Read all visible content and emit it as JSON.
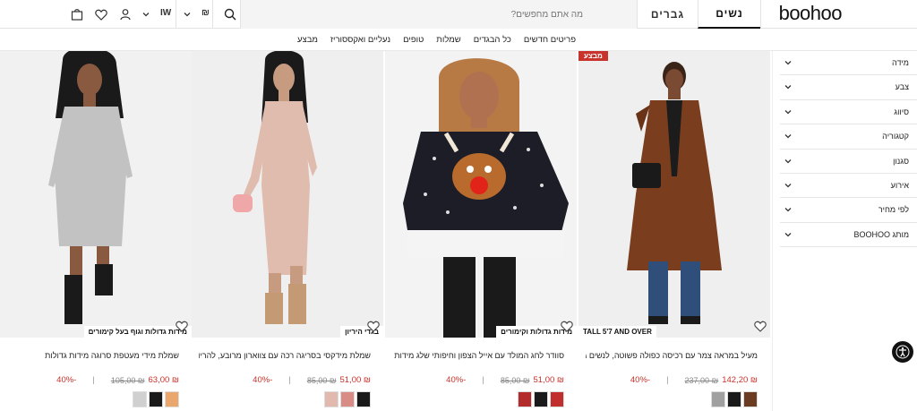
{
  "header": {
    "logo": "boohoo",
    "tabs": [
      {
        "label": "נשים",
        "active": true
      },
      {
        "label": "גברים",
        "active": false
      }
    ],
    "search": {
      "placeholder": "מה אתם מחפשים?"
    },
    "currency": "₪",
    "language": "IW",
    "icons": [
      "search-icon",
      "chevron-down-icon",
      "user-icon",
      "heart-icon",
      "bag-icon"
    ]
  },
  "category_nav": [
    "פריטים חדשים",
    "כל הבגדים",
    "שמלות",
    "טופים",
    "נעליים ואקססוריז",
    "מבצע"
  ],
  "filters": [
    "מידה",
    "צבע",
    "סיווג",
    "קטגוריה",
    "סגנון",
    "אירוע",
    "לפי מחיר",
    "מותג BOOHOO"
  ],
  "products": [
    {
      "title": "מעיל במראה צמר עם רכיסה כפולה פשוטה, לנשים גבוהות",
      "tag": "TALL 5'7 AND OVER",
      "badge": "מבצע",
      "price_now": "₪ 142,20",
      "price_was": "₪ 237,00",
      "discount": "-40%",
      "swatches": [
        "#a0a0a0",
        "#1a1a1a",
        "#6b3c22"
      ]
    },
    {
      "title": "סוודר לחג המולד עם אייל הצפון וחיפותי שלג מידות גדולות",
      "tag": "מידות גדולות וקימורים",
      "badge": "",
      "price_now": "₪ 51,00",
      "price_was": "₪ 85,00",
      "discount": "-40%",
      "swatches": [
        "#b42b2b",
        "#1a1a1a",
        "#c12e2e"
      ]
    },
    {
      "title": "שמלת מידקסי בסריגה רכה עם צווארון מרובע, להריון",
      "tag": "בגדי היריון",
      "badge": "",
      "price_now": "₪ 51,00",
      "price_was": "₪ 85,00",
      "discount": "-40%",
      "swatches": [
        "#e2b9ae",
        "#d98b86",
        "#1a1a1a"
      ]
    },
    {
      "title": "שמלת מידי מעטפת סרוגה מידות גדולות",
      "tag": "מידות גדולות וגוף בעל קימורים",
      "badge": "",
      "price_now": "₪ 63,00",
      "price_was": "₪ 105,00",
      "discount": "-40%",
      "swatches": [
        "#e9a66d",
        "#1a1a1a",
        "#d0d0d0"
      ]
    }
  ],
  "colors": {
    "sale": "#c8332b",
    "text": "#222222",
    "border": "#e3e3e3"
  }
}
